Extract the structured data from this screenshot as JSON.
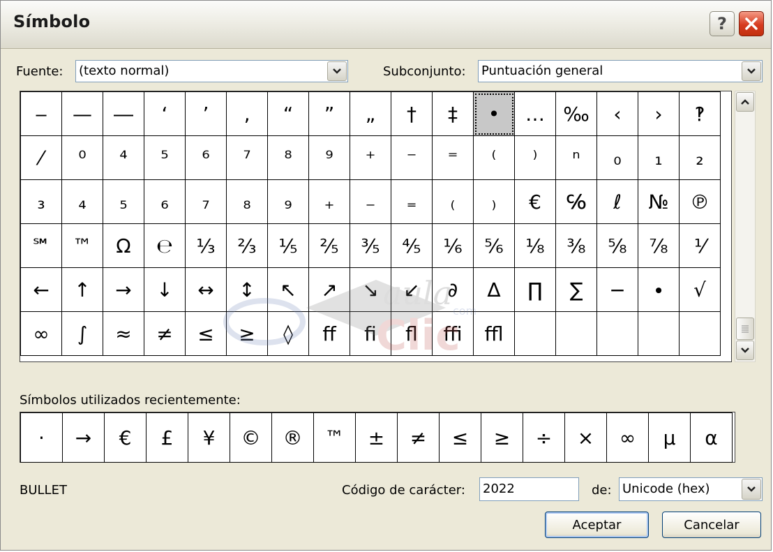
{
  "title": "Símbolo",
  "help_glyph": "?",
  "font_label": "Fuente:",
  "font_value": "(texto normal)",
  "subset_label": "Subconjunto:",
  "subset_value": "Puntuación general",
  "grid": [
    [
      "‒",
      "—",
      "―",
      "‘",
      "’",
      "‚",
      "“",
      "”",
      "„",
      "†",
      "‡",
      "•",
      "…",
      "‰",
      "‹",
      "›",
      "‽"
    ],
    [
      "⁄",
      "⁰",
      "⁴",
      "⁵",
      "⁶",
      "⁷",
      "⁸",
      "⁹",
      "⁺",
      "⁻",
      "⁼",
      "⁽",
      "⁾",
      "ⁿ",
      "₀",
      "₁",
      "₂"
    ],
    [
      "₃",
      "₄",
      "₅",
      "₆",
      "₇",
      "₈",
      "₉",
      "₊",
      "₋",
      "₌",
      "₍",
      "₎",
      "€",
      "℅",
      "ℓ",
      "№",
      "℗"
    ],
    [
      "℠",
      "™",
      "Ω",
      "℮",
      "⅓",
      "⅔",
      "⅕",
      "⅖",
      "⅗",
      "⅘",
      "⅙",
      "⅚",
      "⅛",
      "⅜",
      "⅝",
      "⅞",
      "⅟"
    ],
    [
      "←",
      "↑",
      "→",
      "↓",
      "↔",
      "↕",
      "↖",
      "↗",
      "↘",
      "↙",
      "∂",
      "∆",
      "∏",
      "∑",
      "−",
      "∙",
      "√"
    ],
    [
      "∞",
      "∫",
      "≈",
      "≠",
      "≤",
      "≥",
      "◊",
      "ﬀ",
      "ﬁ",
      "ﬂ",
      "ﬃ",
      "ﬄ",
      "",
      "",
      "",
      "",
      ""
    ]
  ],
  "recent_label": "Símbolos utilizados recientemente:",
  "recent": [
    "·",
    "→",
    "€",
    "£",
    "¥",
    "©",
    "®",
    "™",
    "±",
    "≠",
    "≤",
    "≥",
    "÷",
    "×",
    "∞",
    "µ",
    "α"
  ],
  "char_name": "BULLET",
  "code_label": "Código de carácter:",
  "code_value": "2022",
  "from_label": "de:",
  "from_value": "Unicode (hex)",
  "ok_label": "Aceptar",
  "cancel_label": "Cancelar",
  "watermark": {
    "line1": "aula",
    "line2": "Clic",
    "line3": "com"
  },
  "colors": {
    "dialog_bg": "#ece9d8",
    "close_button": "#d63b1f",
    "selected_cell": "#c8c8c8",
    "border_blue": "#7f9db9"
  }
}
